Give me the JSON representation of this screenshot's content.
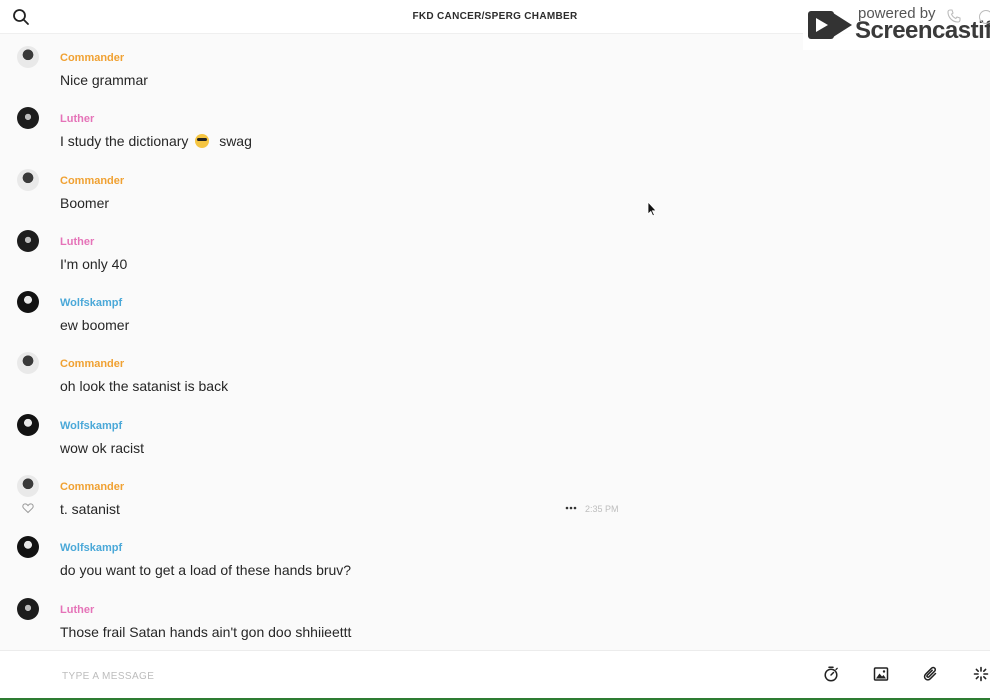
{
  "header": {
    "title": "FKD CANCER/SPERG CHAMBER",
    "search_icon": "search-icon"
  },
  "watermark": {
    "top_text": "powered by",
    "brand": "Screencastify"
  },
  "messages": [
    {
      "sender": "Commander",
      "text": "Nice grammar",
      "avatar": "commander"
    },
    {
      "sender": "Luther",
      "text_before": "I study the dictionary",
      "emoji": "sunglasses-emoji",
      "text_after": "swag",
      "avatar": "luther"
    },
    {
      "sender": "Commander",
      "text": "Boomer",
      "avatar": "commander"
    },
    {
      "sender": "Luther",
      "text": "I'm only 40",
      "avatar": "luther"
    },
    {
      "sender": "Wolfskampf",
      "text": "ew boomer",
      "avatar": "wolf"
    },
    {
      "sender": "Commander",
      "text": "oh look the satanist is back",
      "avatar": "commander"
    },
    {
      "sender": "Wolfskampf",
      "text": "wow ok racist",
      "avatar": "wolf"
    },
    {
      "sender": "Commander",
      "text": "t. satanist",
      "avatar": "commander",
      "time": "2:35 PM"
    },
    {
      "sender": "Wolfskampf",
      "text": "do you want to get a load of these hands bruv?",
      "avatar": "wolf"
    },
    {
      "sender": "Luther",
      "text": "Those frail Satan hands ain't gon doo shhiieettt",
      "avatar": "luther"
    }
  ],
  "composer": {
    "placeholder": "TYPE A MESSAGE"
  },
  "colors": {
    "commander": "#f0a132",
    "luther": "#e573b8",
    "wolfskampf": "#4aa8d8",
    "bottom_line": "#2e7d32"
  }
}
